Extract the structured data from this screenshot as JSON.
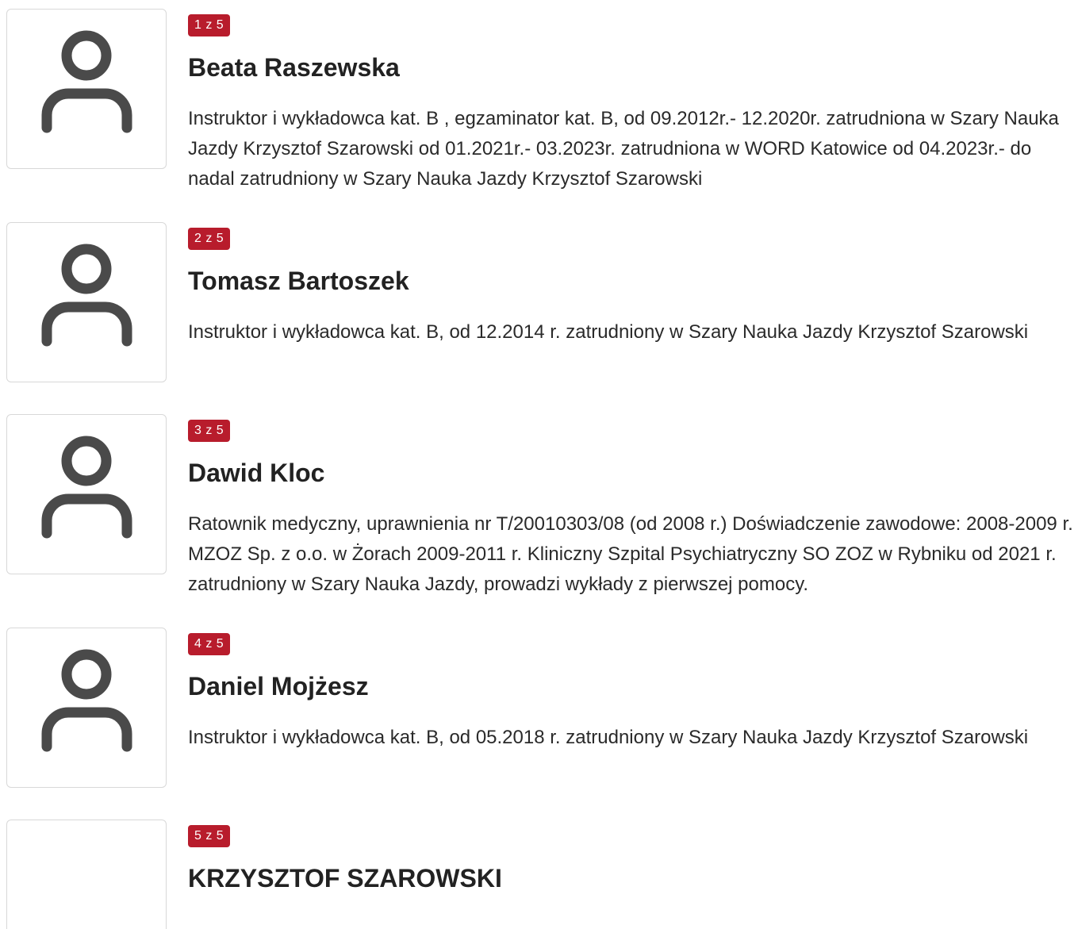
{
  "members": [
    {
      "badge": "1 z 5",
      "name": "Beata Raszewska",
      "description": "Instruktor i wykładowca kat. B , egzaminator kat. B, od 09.2012r.- 12.2020r. zatrudniona w Szary Nauka Jazdy Krzysztof Szarowski od 01.2021r.- 03.2023r. zatrudniona w WORD Katowice od 04.2023r.- do nadal zatrudniony w Szary Nauka Jazdy Krzysztof Szarowski",
      "avatar_icon": "user-placeholder-icon"
    },
    {
      "badge": "2 z 5",
      "name": "Tomasz Bartoszek",
      "description": "Instruktor i wykładowca kat. B, od 12.2014 r. zatrudniony w Szary Nauka Jazdy Krzysztof Szarowski",
      "avatar_icon": "user-placeholder-icon"
    },
    {
      "badge": "3 z 5",
      "name": "Dawid Kloc",
      "description": "Ratownik medyczny, uprawnienia nr T/20010303/08 (od 2008 r.) Doświadczenie zawodowe: 2008-2009 r. MZOZ Sp. z o.o. w Żorach 2009-2011 r. Kliniczny Szpital Psychiatryczny SO ZOZ w Rybniku od 2021 r. zatrudniony w Szary Nauka Jazdy, prowadzi wykłady z pierwszej pomocy.",
      "avatar_icon": "user-placeholder-icon"
    },
    {
      "badge": "4 z 5",
      "name": "Daniel Mojżesz",
      "description": "Instruktor i wykładowca kat. B, od 05.2018 r. zatrudniony w Szary Nauka Jazdy Krzysztof Szarowski",
      "avatar_icon": "user-placeholder-icon"
    },
    {
      "badge": "5 z 5",
      "name": "KRZYSZTOF SZAROWSKI",
      "description": "",
      "avatar_icon": ""
    }
  ],
  "colors": {
    "badge_bg": "#b81c2c",
    "badge_text": "#ffffff",
    "icon": "#4a4a4a",
    "avatar_border": "#d8d8d8"
  }
}
